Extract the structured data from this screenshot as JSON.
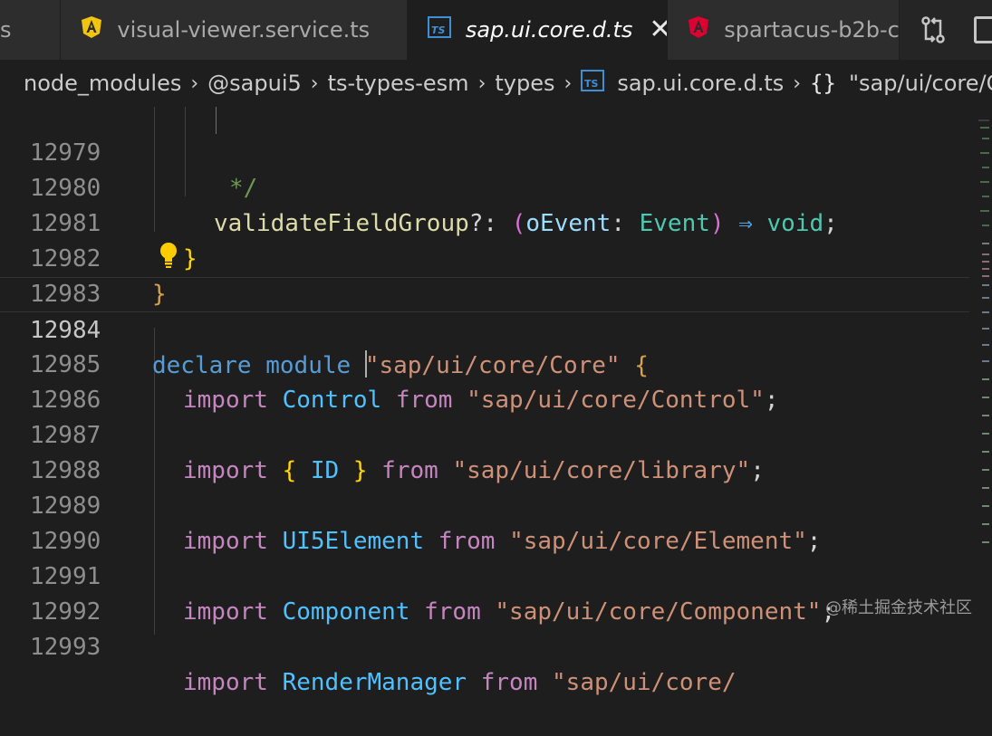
{
  "tabs": [
    {
      "label": "s",
      "icon": "none",
      "active": false
    },
    {
      "label": "visual-viewer.service.ts",
      "icon": "angular-service-icon",
      "active": false
    },
    {
      "label": "sap.ui.core.d.ts",
      "icon": "typescript-file-icon",
      "active": true,
      "close": "✕"
    },
    {
      "label": "spartacus-b2b-co",
      "icon": "angular-icon",
      "active": false
    }
  ],
  "tab_actions": [
    "open-changes-icon",
    "split-editor-icon"
  ],
  "breadcrumb": {
    "parts": [
      "node_modules",
      "@sapui5",
      "ts-types-esm",
      "types",
      "sap.ui.core.d.ts",
      "\"sap/ui/core/C"
    ],
    "separator": "›",
    "symbol_glyph": "{}"
  },
  "colors": {
    "keyword_blue": "#569cd6",
    "keyword_pink": "#c586c0",
    "string": "#ce9178",
    "type": "#4ec9b0",
    "function": "#dcdcaa",
    "comment": "#6a9955",
    "angular_red": "#dd0031",
    "angular_yellow": "#f1c40f",
    "typescript_blue": "#3178c6",
    "lightbulb": "#ffcc00"
  },
  "editor": {
    "lines": [
      {
        "n": "12979",
        "text": "*/"
      },
      {
        "n": "12980",
        "text": "validateFieldGroup?: (oEvent: Event) ⇒ void;"
      },
      {
        "n": "12981",
        "text": "}"
      },
      {
        "n": "12982",
        "text": "}"
      },
      {
        "n": "12983",
        "text": ""
      },
      {
        "n": "12984",
        "text": "declare module \"sap/ui/core/Core\" {"
      },
      {
        "n": "12985",
        "text": "import Control from \"sap/ui/core/Control\";"
      },
      {
        "n": "12986",
        "text": ""
      },
      {
        "n": "12987",
        "text": "import { ID } from \"sap/ui/core/library\";"
      },
      {
        "n": "12988",
        "text": ""
      },
      {
        "n": "12989",
        "text": "import UI5Element from \"sap/ui/core/Element\";"
      },
      {
        "n": "12990",
        "text": ""
      },
      {
        "n": "12991",
        "text": "import Component from \"sap/ui/core/Component\";"
      },
      {
        "n": "12992",
        "text": ""
      },
      {
        "n": "12993",
        "text": "import RenderManager from \"sap/ui/core/"
      }
    ],
    "current_line": "12984",
    "tokens": {
      "l12979": {
        "c": "*/"
      },
      "l12980": {
        "fn": "validateFieldGroup",
        "q": "?:",
        "p1": "(",
        "param": "oEvent",
        "colon": ":",
        "type": "Event",
        "p2": ")",
        "arrow": "⇒",
        "void": "void",
        "semi": ";"
      },
      "l12981": {
        "b": "}"
      },
      "l12982": {
        "b": "}"
      },
      "l12984": {
        "declare": "declare",
        "module": "module",
        "str": "\"sap/ui/core/Core\"",
        "brace": "{"
      },
      "l12985": {
        "import": "import",
        "name": "Control",
        "from": "from",
        "str": "\"sap/ui/core/Control\"",
        "semi": ";"
      },
      "l12987": {
        "import": "import",
        "ob": "{",
        "name": "ID",
        "cb": "}",
        "from": "from",
        "str": "\"sap/ui/core/library\"",
        "semi": ";"
      },
      "l12989": {
        "import": "import",
        "name": "UI5Element",
        "from": "from",
        "str": "\"sap/ui/core/Element\"",
        "semi": ";"
      },
      "l12991": {
        "import": "import",
        "name": "Component",
        "from": "from",
        "str": "\"sap/ui/core/Component\"",
        "semi": ";"
      },
      "l12993": {
        "import": "import",
        "name": "RenderManager",
        "from": "from",
        "str": "\"sap/ui/core/"
      }
    }
  },
  "lightbulb": "lightbulb-icon",
  "watermark": "@稀土掘金技术社区"
}
